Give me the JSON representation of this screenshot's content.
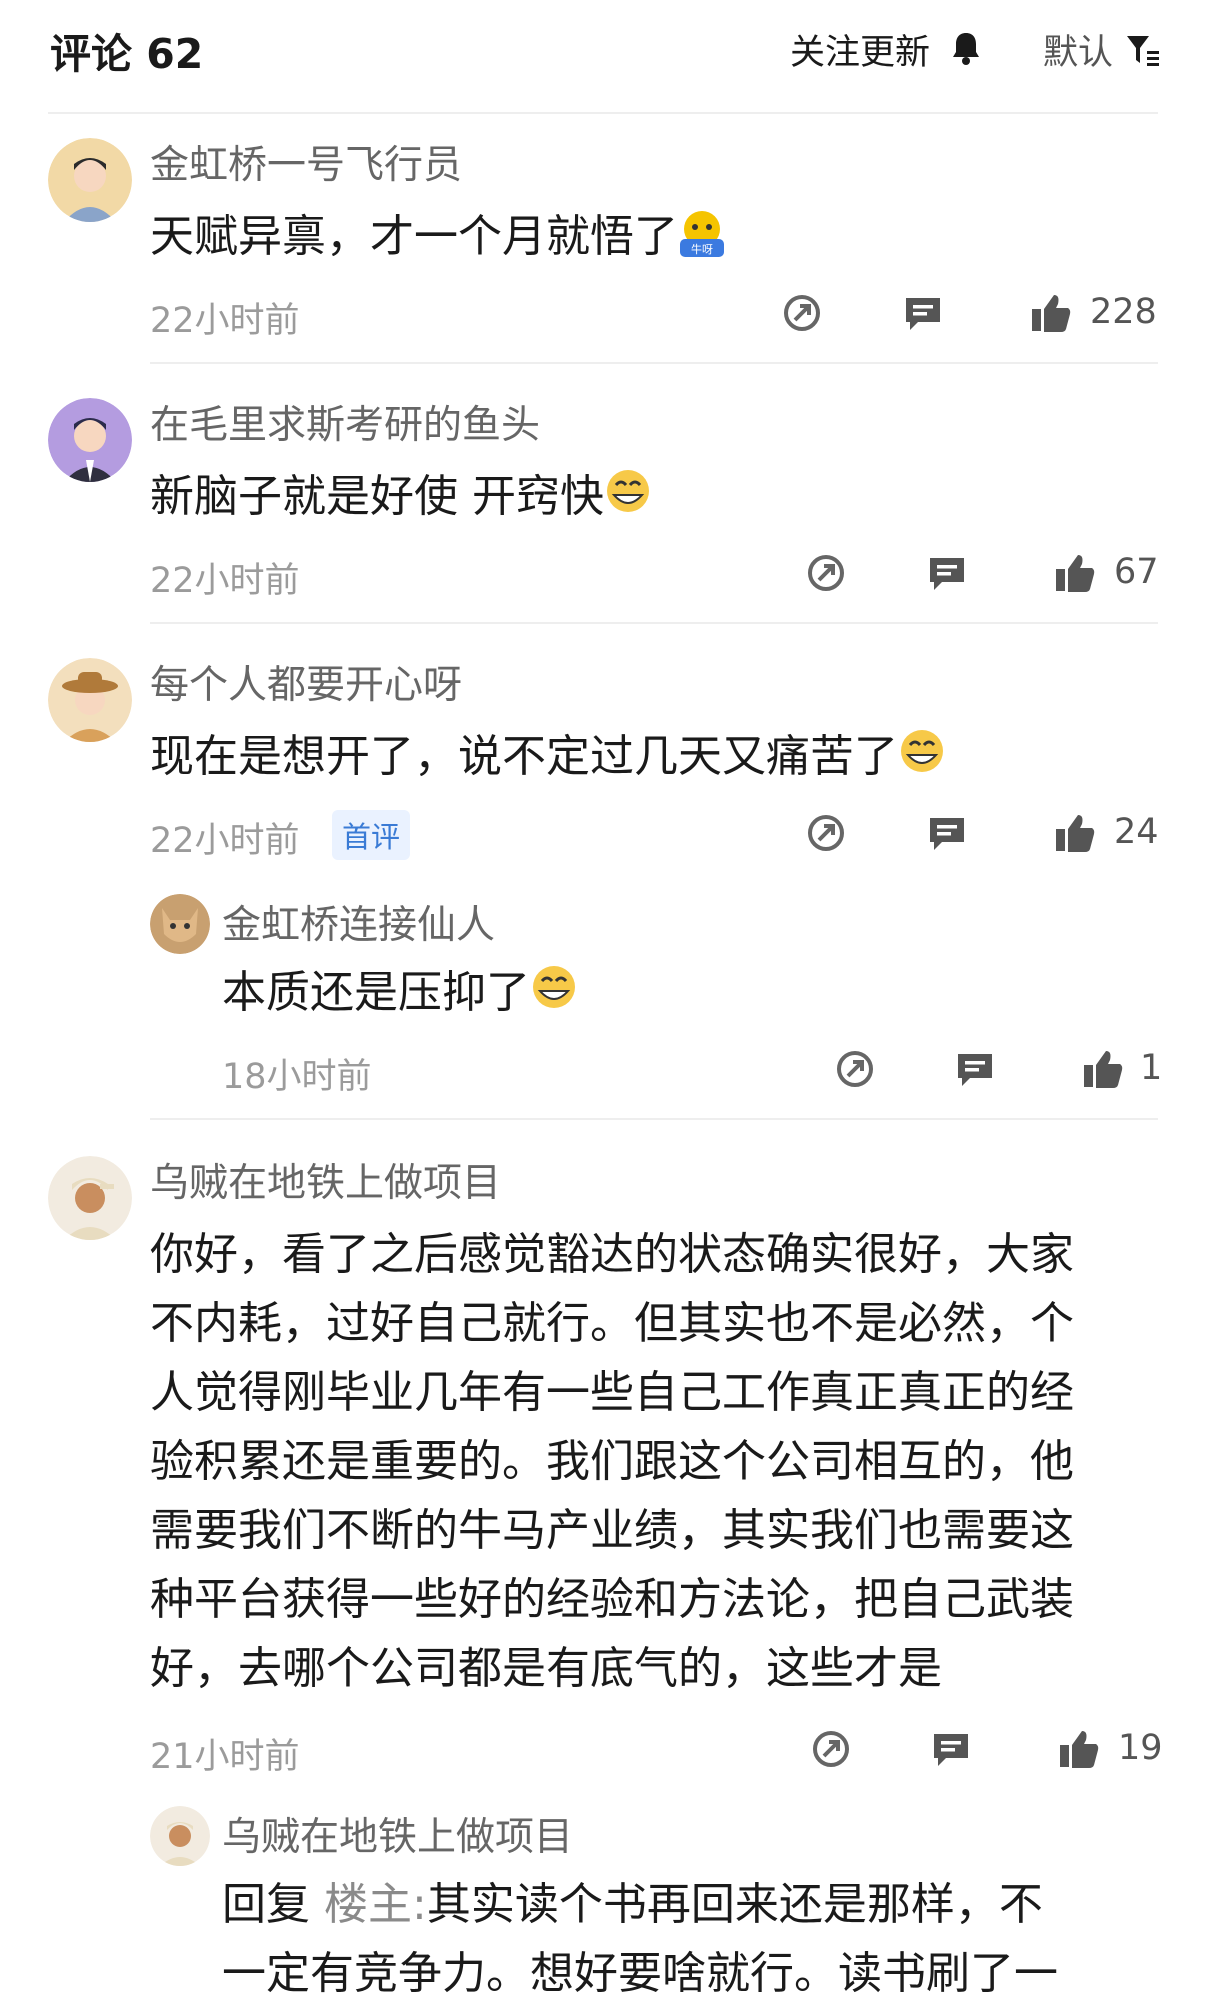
{
  "header": {
    "title": "评论 62",
    "follow_label": "关注更新",
    "sort_label": "默认"
  },
  "comments": [
    {
      "user": "金虹桥一号飞行员",
      "text": "天赋异禀，才一个月就悟了",
      "emoji_label": "牛呀",
      "time": "22小时前",
      "likes": "228"
    },
    {
      "user": "在毛里求斯考研的鱼头",
      "text": "新脑子就是好使 开窍快",
      "time": "22小时前",
      "likes": "67"
    },
    {
      "user": "每个人都要开心呀",
      "text": "现在是想开了，说不定过几天又痛苦了",
      "time": "22小时前",
      "badge": "首评",
      "likes": "24",
      "reply": {
        "user": "金虹桥连接仙人",
        "text": "本质还是压抑了",
        "time": "18小时前",
        "likes": "1"
      }
    },
    {
      "user": "乌贼在地铁上做项目",
      "lines": [
        "你好，看了之后感觉豁达的状态确实很好，大家",
        "不内耗，过好自己就行。但其实也不是必然，个",
        "人觉得刚毕业几年有一些自己工作真正真正的经",
        "验积累还是重要的。我们跟这个公司相互的，他",
        "需要我们不断的牛马产业绩，其实我们也需要这",
        "种平台获得一些好的经验和方法论，把自己武装",
        "好，去哪个公司都是有底气的，这些才是"
      ],
      "time": "21小时前",
      "likes": "19",
      "reply": {
        "user": "乌贼在地铁上做项目",
        "reply_prefix": "回复",
        "reply_target": "楼主:",
        "line1": "其实读个书再回来还是那样，不",
        "line2": "一定有竞争力。想好要啥就行。读书刷了一"
      }
    }
  ]
}
